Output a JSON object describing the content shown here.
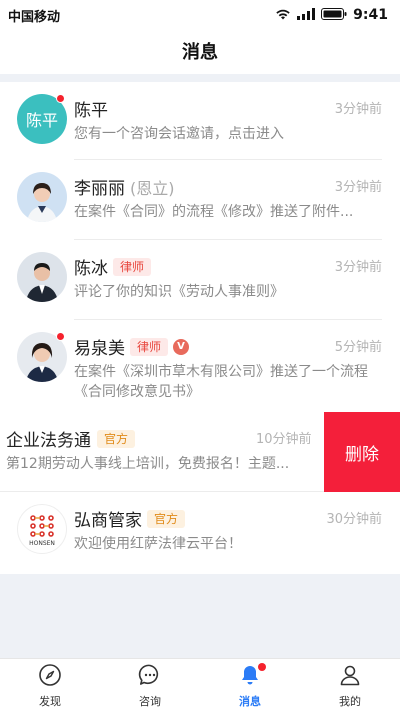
{
  "status_bar": {
    "carrier": "中国移动",
    "time": "9:41"
  },
  "header": {
    "title": "消息"
  },
  "messages": [
    {
      "name": "陈平",
      "avatar_text": "陈平",
      "time": "3分钟前",
      "preview": "您有一个咨询会话邀请，点击进入",
      "unread": true
    },
    {
      "name": "李丽丽",
      "sub_name": "(恩立)",
      "time": "3分钟前",
      "preview": "在案件《合同》的流程《修改》推送了附件...",
      "unread": false
    },
    {
      "name": "陈冰",
      "tag": "律师",
      "time": "3分钟前",
      "preview": "评论了你的知识《劳动人事准则》",
      "unread": false
    },
    {
      "name": "易泉美",
      "tag": "律师",
      "verified": "V",
      "time": "5分钟前",
      "preview": "在案件《深圳市草木有限公司》推送了一个流程《合同修改意见书》",
      "unread": true
    },
    {
      "name": "企业法务通",
      "tag": "官方",
      "time": "10分钟前",
      "preview": "第12期劳动人事线上培训，免费报名！主题..."
    },
    {
      "name": "弘商管家",
      "tag": "官方",
      "time": "30分钟前",
      "preview": "欢迎使用红萨法律云平台！",
      "logo_text": "HONSEN"
    }
  ],
  "delete_label": "删除",
  "tabs": [
    {
      "label": "发现",
      "icon": "compass-icon"
    },
    {
      "label": "咨询",
      "icon": "chat-bubble-icon"
    },
    {
      "label": "消息",
      "icon": "bell-icon",
      "active": true,
      "badge": true
    },
    {
      "label": "我的",
      "icon": "person-icon"
    }
  ],
  "colors": {
    "accent": "#2b7cf6",
    "delete": "#f41f3a",
    "unread": "#f5222d",
    "lawyer_tag": "#e8473e",
    "official_tag": "#e08b1a",
    "avatar_teal": "#3bbfbf"
  }
}
